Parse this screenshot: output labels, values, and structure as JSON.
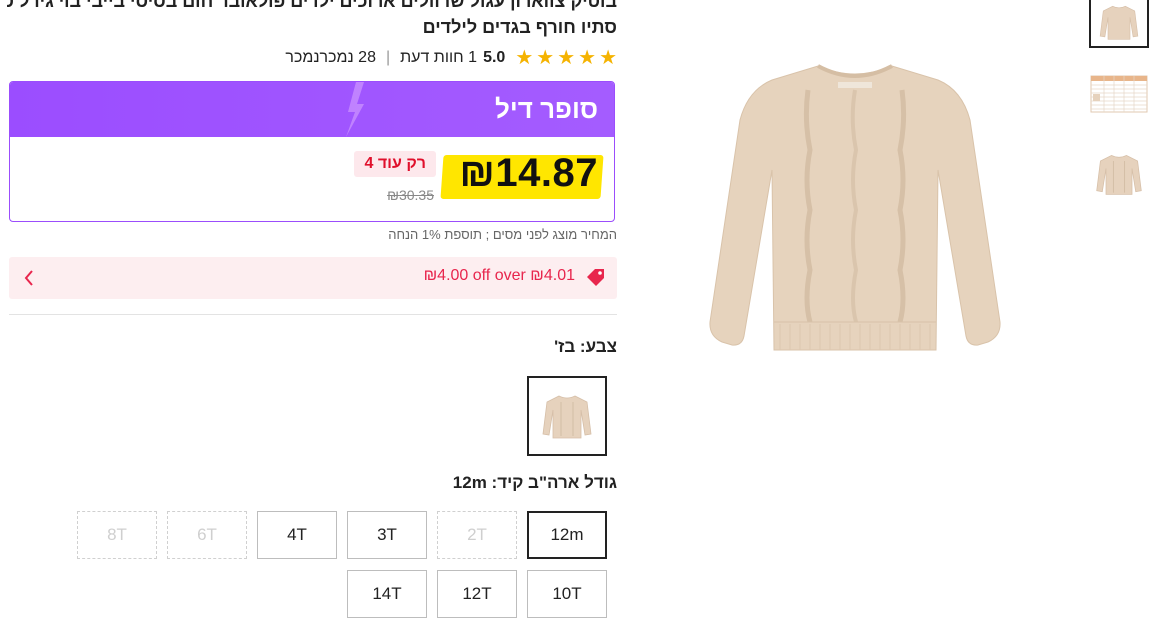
{
  "product": {
    "title_line1": "בוטיק צווארון עגול שרוולים ארוכים ילדים פולאובר חום בסיסי בייבי בוי גירל סריגה",
    "title_line2": "סתיו חורף בגדים לילדים"
  },
  "rating": {
    "value": "5.0",
    "stars": 5,
    "reviews": "1 חוות דעת",
    "sold": "28 נמכרנמכר"
  },
  "deal": {
    "title": "סופר דיל",
    "price": "₪14.87",
    "original_price": "₪30.35",
    "stock_badge": "רק עוד 4"
  },
  "tax_note": "המחיר מוצג לפני מסים ; תוספת 1% הנחה",
  "coupon": {
    "text": "₪4.00 off over ₪4.01"
  },
  "color": {
    "label": "צבע: בז'"
  },
  "size": {
    "label": "גודל ארה\"ב קיד: 12m",
    "options": [
      "12m",
      "2T",
      "3T",
      "4T",
      "6T",
      "8T",
      "10T",
      "12T",
      "14T"
    ],
    "selected": "12m",
    "disabled": [
      "2T",
      "6T",
      "8T"
    ]
  },
  "colors": {
    "accent": "#9b4dff",
    "price_highlight": "#ffe600",
    "sale_red": "#e8264d",
    "star": "#f5b301",
    "sweater": "#e6d2bd"
  }
}
